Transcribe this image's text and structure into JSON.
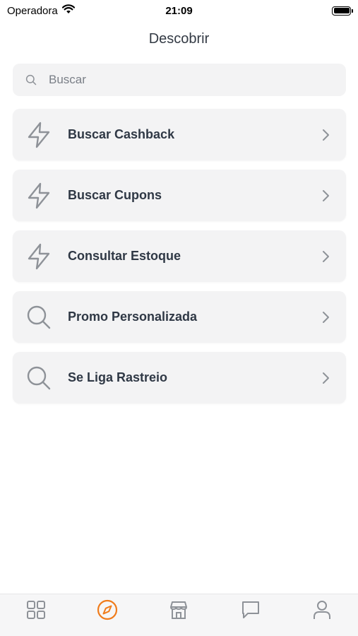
{
  "status_bar": {
    "carrier": "Operadora",
    "time": "21:09"
  },
  "header": {
    "title": "Descobrir"
  },
  "search": {
    "placeholder": "Buscar"
  },
  "menu": [
    {
      "label": "Buscar Cashback",
      "icon": "lightning-icon"
    },
    {
      "label": "Buscar Cupons",
      "icon": "lightning-icon"
    },
    {
      "label": "Consultar Estoque",
      "icon": "lightning-icon"
    },
    {
      "label": "Promo Personalizada",
      "icon": "search-icon"
    },
    {
      "label": "Se Liga Rastreio",
      "icon": "search-icon"
    }
  ],
  "tabs": [
    {
      "icon": "grid-icon",
      "active": false
    },
    {
      "icon": "compass-icon",
      "active": true
    },
    {
      "icon": "store-icon",
      "active": false
    },
    {
      "icon": "chat-icon",
      "active": false
    },
    {
      "icon": "user-icon",
      "active": false
    }
  ],
  "colors": {
    "accent": "#f07c1c",
    "icon_gray": "#8e9298",
    "text_dark": "#2f3845"
  }
}
